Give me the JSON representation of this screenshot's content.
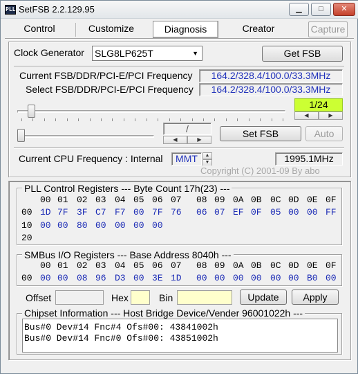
{
  "window": {
    "title": "SetFSB 2.2.129.95",
    "icon_text": "PLL",
    "minimize_glyph": "▁",
    "maximize_glyph": "□",
    "close_glyph": "✕"
  },
  "tabs": [
    {
      "label": "Control",
      "active": false
    },
    {
      "label": "Customize",
      "active": false
    },
    {
      "label": "Diagnosis",
      "active": true
    },
    {
      "label": "Creator",
      "active": false
    },
    {
      "label": "Capture",
      "active": false,
      "disabled": true
    }
  ],
  "clock": {
    "label": "Clock Generator",
    "selected": "SLG8LP625T",
    "get_fsb_label": "Get FSB"
  },
  "frequencies": {
    "current_label": "Current FSB/DDR/PCI-E/PCI Frequency",
    "current_value": "164.2/328.4/100.0/33.3MHz",
    "select_label": "Select FSB/DDR/PCI-E/PCI Frequency",
    "select_value": "164.2/328.4/100.0/33.3MHz",
    "slider_counter": "1/24",
    "slider_position": 0.04,
    "secondary_slider_position": 0.0,
    "ratio_placeholder": "/",
    "set_fsb_label": "Set FSB",
    "auto_label": "Auto"
  },
  "cpu": {
    "label": "Current CPU Frequency : Internal",
    "source": "MMT",
    "value": "1995.1MHz",
    "copyright": "Copyright (C) 2001-09 By abo"
  },
  "pll": {
    "title": "PLL Control Registers  --- Byte Count 17h(23) ---",
    "header": [
      "00",
      "01",
      "02",
      "03",
      "04",
      "05",
      "06",
      "07",
      "08",
      "09",
      "0A",
      "0B",
      "0C",
      "0D",
      "0E",
      "0F"
    ],
    "rows": [
      {
        "label": "00",
        "cells": [
          "1D",
          "7F",
          "3F",
          "C7",
          "F7",
          "00",
          "7F",
          "76",
          "06",
          "07",
          "EF",
          "0F",
          "05",
          "00",
          "00",
          "FF"
        ]
      },
      {
        "label": "10",
        "cells": [
          "00",
          "00",
          "80",
          "00",
          "00",
          "00",
          "00",
          "",
          "",
          "",
          "",
          "",
          "",
          "",
          "",
          ""
        ]
      },
      {
        "label": "20",
        "cells": [
          "",
          "",
          "",
          "",
          "",
          "",
          "",
          "",
          "",
          "",
          "",
          "",
          "",
          "",
          "",
          ""
        ]
      }
    ]
  },
  "smbus": {
    "title": "SMBus I/O Registers  --- Base Address 8040h ---",
    "header": [
      "00",
      "01",
      "02",
      "03",
      "04",
      "05",
      "06",
      "07",
      "08",
      "09",
      "0A",
      "0B",
      "0C",
      "0D",
      "0E",
      "0F"
    ],
    "rows": [
      {
        "label": "00",
        "cells": [
          "00",
          "00",
          "08",
          "96",
          "D3",
          "00",
          "3E",
          "1D",
          "00",
          "00",
          "00",
          "00",
          "00",
          "00",
          "B0",
          "00"
        ]
      }
    ]
  },
  "io": {
    "offset_label": "Offset",
    "offset_value": "",
    "hex_label": "Hex",
    "hex_value": "",
    "bin_label": "Bin",
    "bin_value": "",
    "update_label": "Update",
    "apply_label": "Apply"
  },
  "chipset": {
    "title": "Chipset Information  --- Host Bridge Device/Vender 96001022h ---",
    "lines": [
      "Bus#0 Dev#14 Fnc#4 Ofs#00: 43841002h",
      "Bus#0 Dev#14 Fnc#0 Ofs#00: 43851002h"
    ]
  }
}
